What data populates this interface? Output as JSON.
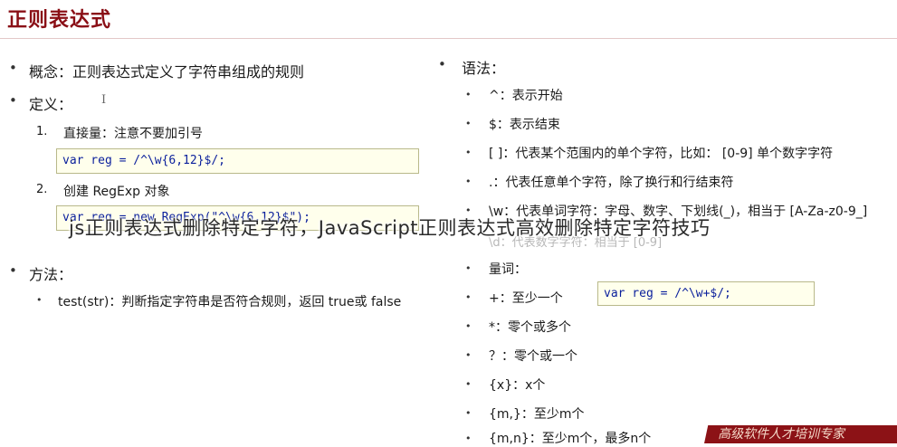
{
  "title": "正则表达式",
  "left": {
    "concept": "概念：正则表达式定义了字符串组成的规则",
    "definition": "定义：",
    "def_items": [
      {
        "num": "1.",
        "label": "直接量：注意不要加引号",
        "code": "var reg = /^\\w{6,12}$/;"
      },
      {
        "num": "2.",
        "label": "创建 RegExp 对象",
        "code": "var reg = new RegExp(\"^\\w{6,12}$\");"
      }
    ],
    "method": "方法：",
    "method_item": "test(str)：判断指定字符串是否符合规则，返回 true或 false"
  },
  "right": {
    "syntax": "语法：",
    "items": [
      "^：表示开始",
      "$：表示结束",
      "[ ]：代表某个范围内的单个字符，比如： [0-9] 单个数字字符",
      ".：代表任意单个字符，除了换行和行结束符",
      "\\w：代表单词字符：字母、数字、下划线(_)，相当于 [A-Za-z0-9_]",
      "量词：",
      "+：至少一个",
      "*：零个或多个",
      "？：零个或一个",
      "{x}：x个",
      "{m,}：至少m个",
      "{m,n}：至少m个，最多n个"
    ],
    "faded_line": "\\d：代表数字字符：相当于 [0-9]",
    "plus_code": "var reg = /^\\w+$/;"
  },
  "overlay_caption": "js正则表达式删除特定字符，JavaScript正则表达式高效删除特定字符技巧",
  "watermark": "高级软件人才培训专家",
  "icons": {
    "bullet": "bullet-dot-icon",
    "cursor": "text-cursor-icon"
  },
  "colors": {
    "title": "#8a0f16",
    "code_bg": "#ffffec",
    "code_text": "#0a1f9c",
    "watermark_bg": "#8c1216"
  }
}
